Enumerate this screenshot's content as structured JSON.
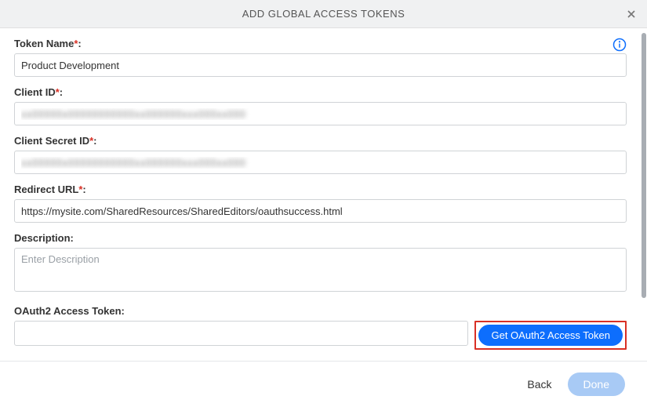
{
  "header": {
    "title": "ADD GLOBAL ACCESS TOKENS"
  },
  "fields": {
    "tokenName": {
      "label": "Token Name",
      "value": "Product Development"
    },
    "clientId": {
      "label": "Client ID",
      "value": "xx00000x00000000000xx000000xxx000xx000"
    },
    "clientSecret": {
      "label": "Client Secret ID",
      "value": "xx00000x00000000000xx000000xxx000xx000"
    },
    "redirectUrl": {
      "label": "Redirect URL",
      "value": "https://mysite.com/SharedResources/SharedEditors/oauthsuccess.html"
    },
    "description": {
      "label": "Description",
      "placeholder": "Enter Description",
      "value": ""
    },
    "oauthToken": {
      "label": "OAuth2 Access Token",
      "value": ""
    }
  },
  "buttons": {
    "getToken": "Get OAuth2 Access Token",
    "back": "Back",
    "done": "Done"
  }
}
